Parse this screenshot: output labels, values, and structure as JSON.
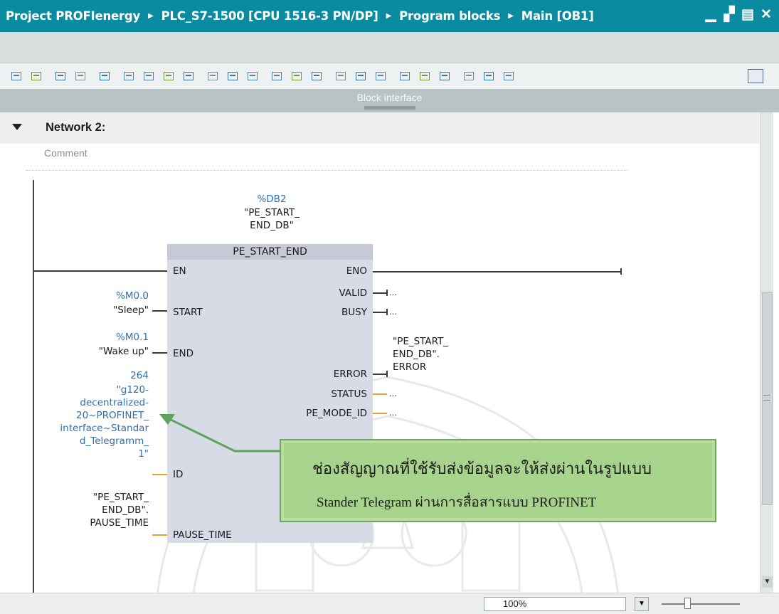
{
  "window": {
    "breadcrumb": [
      "Project PROFIenergy",
      "PLC_S7-1500 [CPU 1516-3 PN/DP]",
      "Program blocks",
      "Main [OB1]"
    ],
    "controls": [
      "minimize-icon",
      "restore-icon",
      "maximize-icon",
      "close-icon"
    ]
  },
  "toolbar": {
    "icons": [
      "insert-network-icon",
      "delete-network-icon",
      "insert-row-icon",
      "add-row-icon",
      "absolute-operand-icon",
      "network-overview-icon",
      "open-all-networks-icon",
      "close-all-networks-icon",
      "network-comments-icon",
      "favorites-icon",
      "empty-box-icon",
      "ladder-box-icon",
      "open-branch-icon",
      "close-branch-icon",
      "monitoring-icon",
      "modify-icon",
      "force-icon",
      "go-online-icon",
      "go-offline-icon",
      "call-hierarchy-icon",
      "cross-reference-icon",
      "assignment-icon",
      "compare-icon",
      "download-icon",
      "layout-icon"
    ]
  },
  "interface_bar": {
    "label": "Block interface"
  },
  "network": {
    "title": "Network 2:",
    "comment": "Comment"
  },
  "block": {
    "instance_addr": "%DB2",
    "instance_name_1": "\"PE_START_",
    "instance_name_2": "END_DB\"",
    "type": "PE_START_END",
    "inputs": [
      "EN",
      "START",
      "END",
      "ID",
      "PAUSE_TIME"
    ],
    "outputs": [
      "ENO",
      "VALID",
      "BUSY",
      "ERROR",
      "STATUS",
      "PE_MODE_ID"
    ]
  },
  "operands": {
    "start_addr": "%M0.0",
    "start_name": "\"Sleep\"",
    "end_addr": "%M0.1",
    "end_name": "\"Wake up\"",
    "id_value": "264",
    "id_name_lines": [
      "\"g120-",
      "decentralized-",
      "20~PROFINET_",
      "interface~Standar",
      "d_Telegramm_",
      "1\""
    ],
    "pause_lines": [
      "\"PE_START_",
      "END_DB\".",
      "PAUSE_TIME"
    ],
    "error_lines": [
      "\"PE_START_",
      "END_DB\".",
      "ERROR"
    ],
    "placeholder": "..."
  },
  "annotation": {
    "line1": "ช่องสัญญาณที่ใช้รับส่งข้อมูลจะให้ส่งผ่านในรูปแบบ",
    "line2": "Stander Telegram ผ่านการสื่อสารแบบ  PROFINET"
  },
  "status": {
    "zoom": "100%"
  },
  "colors": {
    "titlebar": "#0b8ba0",
    "block_fill": "#d7dbe5",
    "wire_bool": "#3a3a3a",
    "wire_word": "#e3a628",
    "operand_address": "#2f6fb3",
    "annotation_fill": "#a8d38d",
    "annotation_arrow": "#5fa35a"
  }
}
